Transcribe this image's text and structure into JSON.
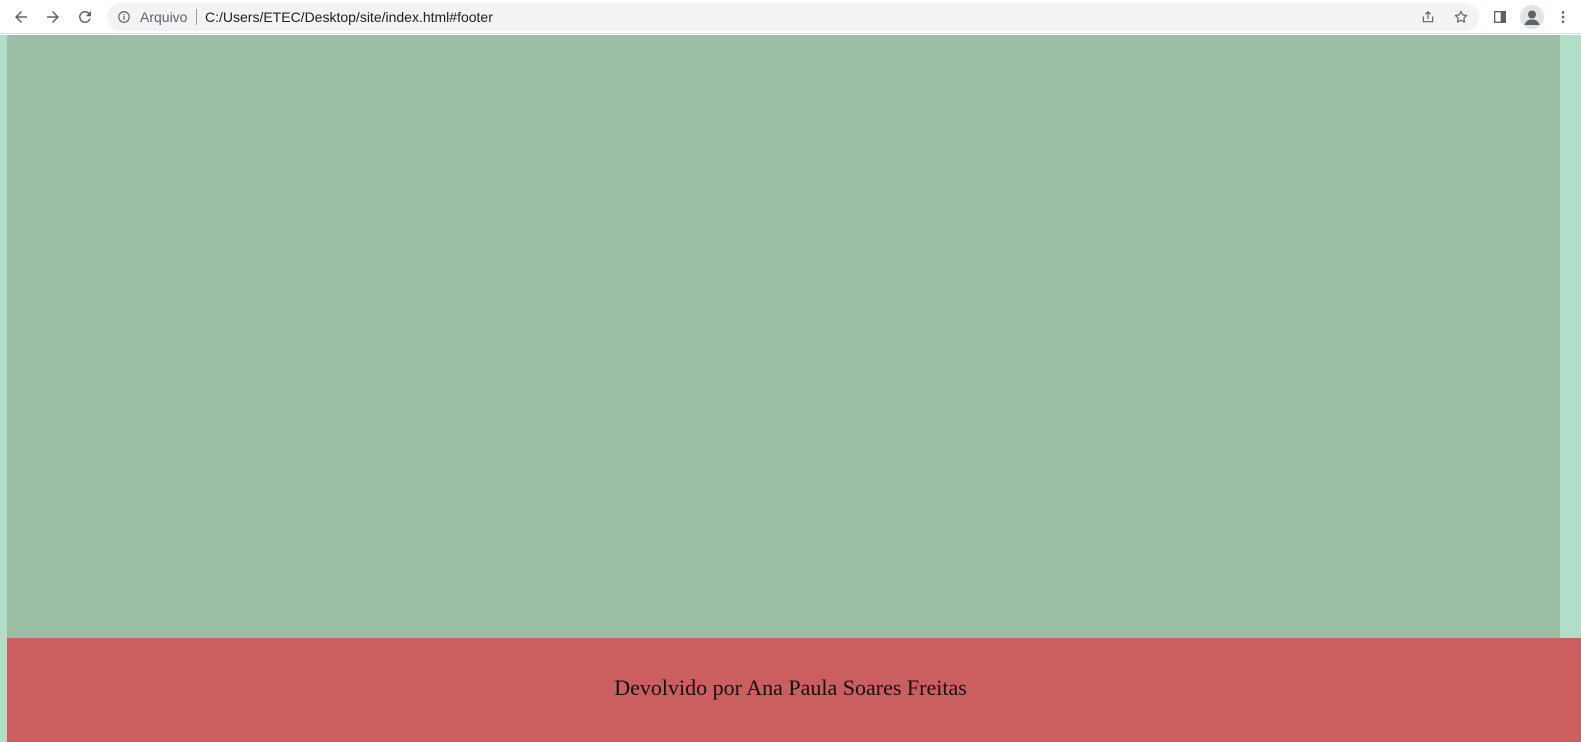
{
  "browser": {
    "back_icon": "arrow-left-icon",
    "forward_icon": "arrow-right-icon",
    "reload_icon": "reload-icon",
    "site_info_icon": "info-icon",
    "site_chip_label": "Arquivo",
    "url": "C:/Users/ETEC/Desktop/site/index.html#footer",
    "share_icon": "share-icon",
    "bookmark_icon": "star-icon",
    "side_panel_icon": "side-panel-icon",
    "profile_icon": "person-icon",
    "menu_icon": "vertical-dots-icon",
    "icon_color": "#5f6368"
  },
  "page": {
    "colors": {
      "page_background": "#b1dec7",
      "section_background": "#9abfa5",
      "footer_background": "#cb5f60",
      "footer_text": "#111111"
    },
    "footer": {
      "text": "Devolvido por Ana Paula Soares Freitas"
    }
  }
}
